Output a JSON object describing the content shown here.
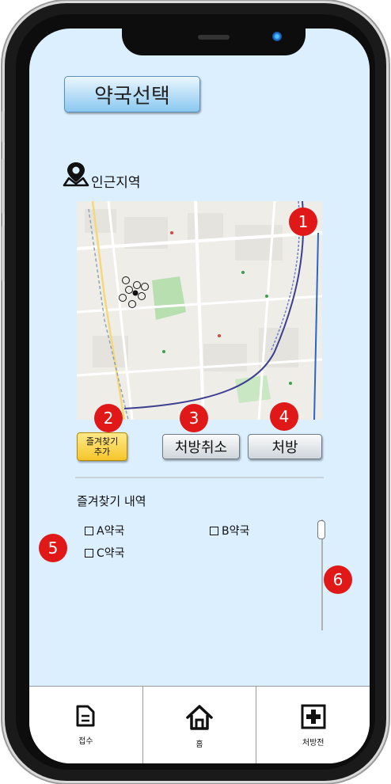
{
  "screen_title": "약국선택",
  "nearby": {
    "label": "인근지역"
  },
  "buttons": {
    "favorite_add": "즐겨찾기\n추가",
    "favorite_line1": "즐겨찾기",
    "favorite_line2": "추가",
    "cancel_prescription": "처방취소",
    "prescription": "처방"
  },
  "favorites": {
    "title": "즐겨찾기 내역",
    "items": [
      "A약국",
      "B약국",
      "C약국"
    ]
  },
  "annotations": [
    "1",
    "2",
    "3",
    "4",
    "5",
    "6"
  ],
  "tabbar": {
    "tabs": [
      {
        "label": "접수",
        "icon": "document-icon"
      },
      {
        "label": "홈",
        "icon": "home-icon"
      },
      {
        "label": "처방전",
        "icon": "plus-square-icon"
      }
    ]
  },
  "colors": {
    "screen_bg": "#dcefff",
    "badge": "#e01818",
    "favorite_button": "#f6c52a"
  }
}
